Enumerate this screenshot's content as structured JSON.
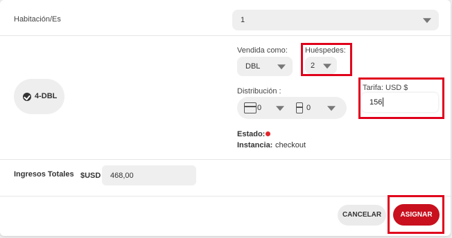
{
  "room": {
    "label": "Habitación/Es",
    "selected": "1"
  },
  "room_type": {
    "label": "4-DBL"
  },
  "sold_as": {
    "label": "Vendida como:",
    "selected": "DBL"
  },
  "guests": {
    "label": "Huéspedes:",
    "selected": "2"
  },
  "distribution": {
    "label": "Distribución :",
    "double_value": "0",
    "single_value": "0"
  },
  "rate": {
    "label": "Tarifa: USD $",
    "value": "156"
  },
  "status": {
    "label": "Estado:",
    "dot_color": "#e0262b",
    "instance_label": "Instancia:",
    "instance_value": "checkout"
  },
  "income": {
    "label": "Ingresos Totales",
    "currency": "$USD",
    "value": "468,00"
  },
  "actions": {
    "cancel": "CANCELAR",
    "assign": "ASIGNAR"
  },
  "colors": {
    "accent": "#c8101e",
    "highlight": "#e0001b"
  }
}
